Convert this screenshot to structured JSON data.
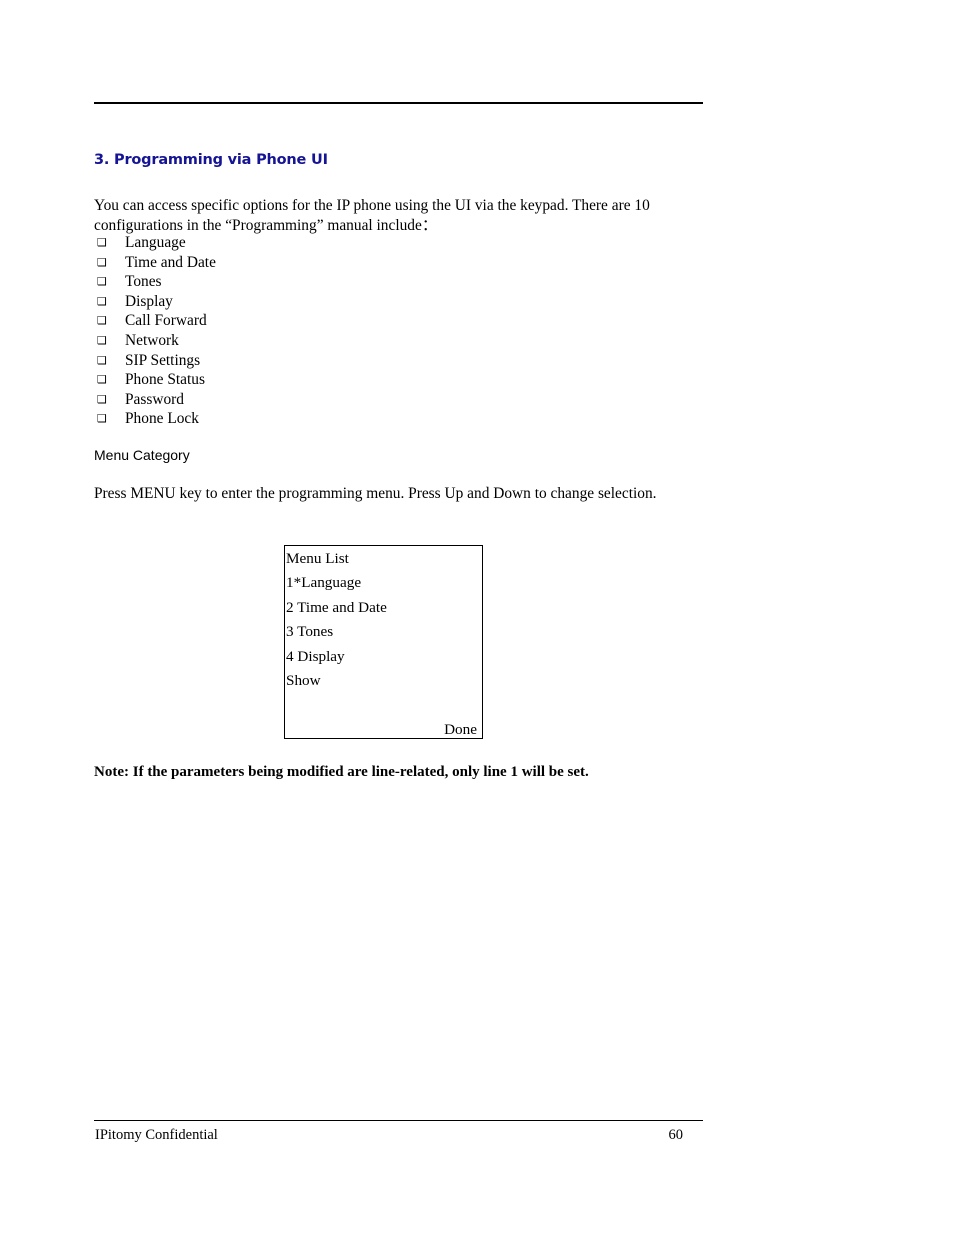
{
  "document": {
    "page_number": "60",
    "footer_text": "IPitomy Confidential",
    "heading_color": "#141494"
  },
  "section": {
    "heading": "3. Programming via Phone UI",
    "intro_paragraph": "You can access specific options for the IP phone using the UI via the keypad. There are 10 configurations in the “Programming” manual include：",
    "bullet_marker": "❑",
    "bullets": [
      {
        "label": "Language"
      },
      {
        "label": "Time and Date"
      },
      {
        "label": "Tones"
      },
      {
        "label": "Display"
      },
      {
        "label": "Call Forward"
      },
      {
        "label": "Network"
      },
      {
        "label": "SIP Settings"
      },
      {
        "label": "Phone Status"
      },
      {
        "label": "Password"
      },
      {
        "label": "Phone Lock"
      }
    ]
  },
  "menu_category": {
    "heading": "Menu Category",
    "instruction": "Press MENU key to enter the programming menu. Press Up and Down to change selection."
  },
  "phone_screen": {
    "title": "Menu List",
    "items": [
      {
        "label": "1*Language"
      },
      {
        "label": "2 Time and Date"
      },
      {
        "label": "3 Tones"
      },
      {
        "label": "4 Display"
      }
    ],
    "softkey_left": "Show",
    "softkey_right": "Done"
  },
  "note": {
    "text": "Note: If the parameters being modified are line-related, only line 1 will be set."
  }
}
